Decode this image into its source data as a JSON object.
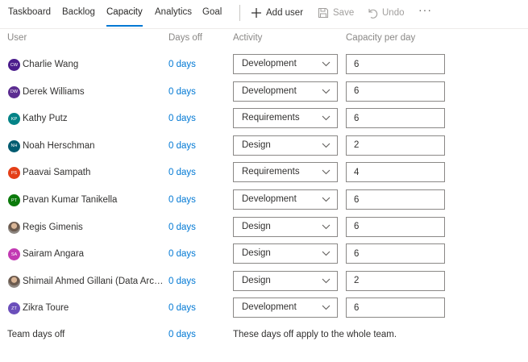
{
  "tabs": [
    {
      "label": "Taskboard",
      "active": false
    },
    {
      "label": "Backlog",
      "active": false
    },
    {
      "label": "Capacity",
      "active": true
    },
    {
      "label": "Analytics",
      "active": false
    },
    {
      "label": "Goal",
      "active": false
    }
  ],
  "toolbar": {
    "add_user": "Add user",
    "save": "Save",
    "undo": "Undo",
    "more": "···"
  },
  "columns": {
    "user": "User",
    "days_off": "Days off",
    "activity": "Activity",
    "capacity": "Capacity per day"
  },
  "members": [
    {
      "initials": "CW",
      "avatar_color": "#4b1d8c",
      "name": "Charlie Wang",
      "days_off": "0 days",
      "activity": "Development",
      "capacity": "6"
    },
    {
      "initials": "DW",
      "avatar_color": "#5c2d91",
      "name": "Derek Williams",
      "days_off": "0 days",
      "activity": "Development",
      "capacity": "6"
    },
    {
      "initials": "KP",
      "avatar_color": "#038387",
      "name": "Kathy Putz",
      "days_off": "0 days",
      "activity": "Requirements",
      "capacity": "6"
    },
    {
      "initials": "NH",
      "avatar_color": "#005b70",
      "name": "Noah Herschman",
      "days_off": "0 days",
      "activity": "Design",
      "capacity": "2"
    },
    {
      "initials": "PS",
      "avatar_color": "#e43f17",
      "name": "Paavai Sampath",
      "days_off": "0 days",
      "activity": "Requirements",
      "capacity": "4"
    },
    {
      "initials": "PT",
      "avatar_color": "#0b7a0b",
      "name": "Pavan Kumar Tanikella",
      "days_off": "0 days",
      "activity": "Development",
      "capacity": "6"
    },
    {
      "initials": "",
      "avatar_color": "photo",
      "name": "Regis Gimenis",
      "days_off": "0 days",
      "activity": "Design",
      "capacity": "6"
    },
    {
      "initials": "SA",
      "avatar_color": "#c239b3",
      "name": "Sairam Angara",
      "days_off": "0 days",
      "activity": "Design",
      "capacity": "6"
    },
    {
      "initials": "",
      "avatar_color": "photo",
      "name": "Shimail Ahmed Gillani (Data Architect)",
      "days_off": "0 days",
      "activity": "Design",
      "capacity": "2"
    },
    {
      "initials": "ZT",
      "avatar_color": "#6b4fbb",
      "name": "Zikra Toure",
      "days_off": "0 days",
      "activity": "Development",
      "capacity": "6"
    }
  ],
  "footer": {
    "label": "Team days off",
    "days_off": "0 days",
    "note": "These days off apply to the whole team."
  },
  "colors": {
    "accent": "#0078d4",
    "disabled": "#a19f9d"
  }
}
